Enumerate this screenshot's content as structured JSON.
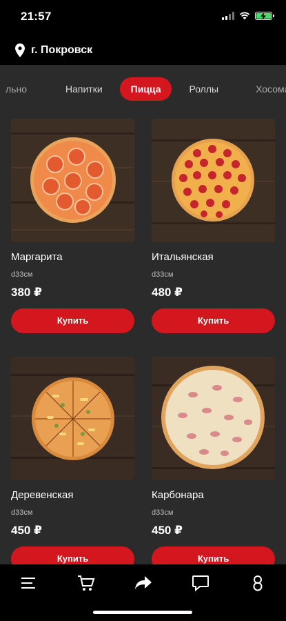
{
  "status_bar": {
    "time": "21:57"
  },
  "location": {
    "city": "г. Покровск",
    "icon": "location-pin-icon"
  },
  "categories": {
    "items": [
      "льно",
      "Напитки",
      "Пицца",
      "Роллы",
      "Хосома"
    ],
    "active": "Пицца"
  },
  "products": [
    {
      "name": "Маргарита",
      "size": "d33см",
      "price": "380 ₽",
      "buy_label": "Купить"
    },
    {
      "name": "Итальянская",
      "size": "d33см",
      "price": "480 ₽",
      "buy_label": "Купить"
    },
    {
      "name": "Деревенская",
      "size": "d33см",
      "price": "450 ₽",
      "buy_label": "Купить"
    },
    {
      "name": "Карбонара",
      "size": "d33см",
      "price": "450 ₽",
      "buy_label": "Купить"
    }
  ],
  "bottom_nav": {
    "icons": [
      "menu-icon",
      "cart-icon",
      "share-icon",
      "chat-icon",
      "profile-icon"
    ]
  },
  "colors": {
    "accent": "#d4171f",
    "background": "#2b2b2b",
    "bars": "#000000"
  }
}
